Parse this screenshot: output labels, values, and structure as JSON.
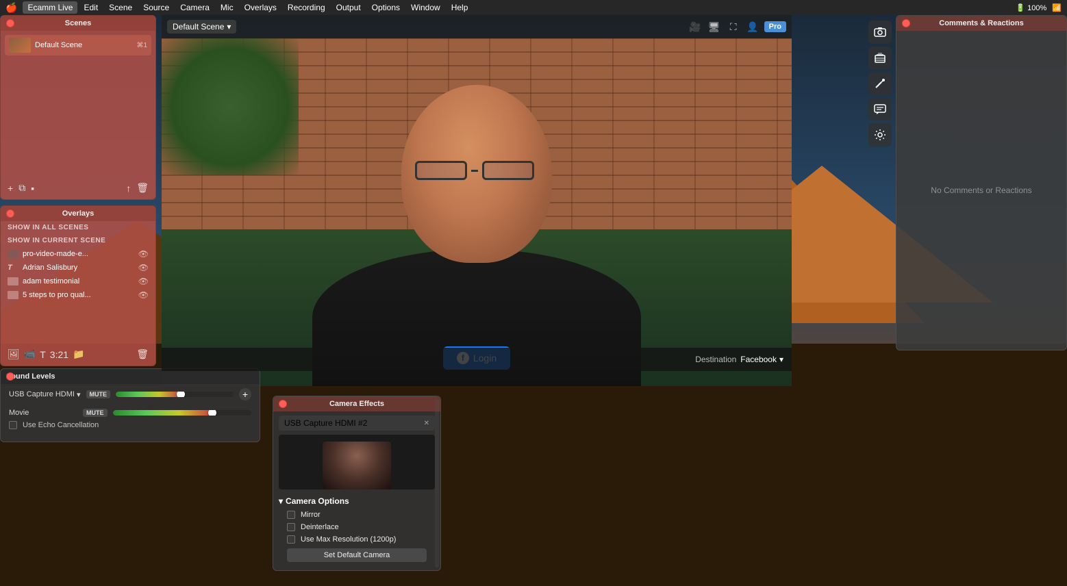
{
  "menubar": {
    "apple": "🍎",
    "app_name": "Ecamm Live",
    "items": [
      {
        "label": "Edit"
      },
      {
        "label": "Scene"
      },
      {
        "label": "Source"
      },
      {
        "label": "Camera"
      },
      {
        "label": "Mic"
      },
      {
        "label": "Overlays"
      },
      {
        "label": "Recording"
      },
      {
        "label": "Output"
      },
      {
        "label": "Options"
      },
      {
        "label": "Window"
      },
      {
        "label": "Help"
      }
    ],
    "right": {
      "battery": "100%",
      "time": ""
    }
  },
  "scenes_panel": {
    "title": "Scenes",
    "scene_item": {
      "name": "Default Scene",
      "shortcut": "⌘1"
    },
    "toolbar": {
      "add": "+",
      "duplicate": "⧉",
      "folder": "📁",
      "share": "↑",
      "delete": "🗑"
    }
  },
  "overlays_panel": {
    "title": "Overlays",
    "show_all_scenes": "SHOW IN ALL SCENES",
    "show_current_scene": "SHOW IN CURRENT SCENE",
    "items": [
      {
        "name": "pro-video-made-e...",
        "type": "video"
      },
      {
        "name": "Adrian Salisbury",
        "type": "text"
      },
      {
        "name": "adam testimonial",
        "type": "image"
      },
      {
        "name": "5 steps to pro qual...",
        "type": "image"
      }
    ]
  },
  "video": {
    "scene_dropdown": "Default Scene",
    "login_btn": "Login",
    "destination_label": "Destination",
    "destination_value": "Facebook"
  },
  "right_sidebar": {
    "icons": [
      {
        "name": "camera-icon",
        "symbol": "📷"
      },
      {
        "name": "layers-icon",
        "symbol": "⊞"
      },
      {
        "name": "wand-icon",
        "symbol": "✦"
      },
      {
        "name": "chat-icon",
        "symbol": "💬"
      },
      {
        "name": "settings-icon",
        "symbol": "⚙"
      }
    ]
  },
  "comments_panel": {
    "title": "Comments & Reactions",
    "empty_message": "No Comments or Reactions"
  },
  "sound_panel": {
    "title": "Sound Levels",
    "usb_device": "USB Capture HDMI",
    "movie_label": "Movie",
    "mute_label": "MUTE",
    "echo_label": "Use Echo Cancellation",
    "volume_percent": 55
  },
  "camera_effects_panel": {
    "title": "Camera Effects",
    "camera_device": "USB Capture HDMI #2",
    "camera_options_label": "Camera Options",
    "options": [
      {
        "label": "Mirror"
      },
      {
        "label": "Deinterlace"
      },
      {
        "label": "Use Max Resolution (1200p)"
      }
    ],
    "set_default_btn": "Set Default Camera"
  }
}
